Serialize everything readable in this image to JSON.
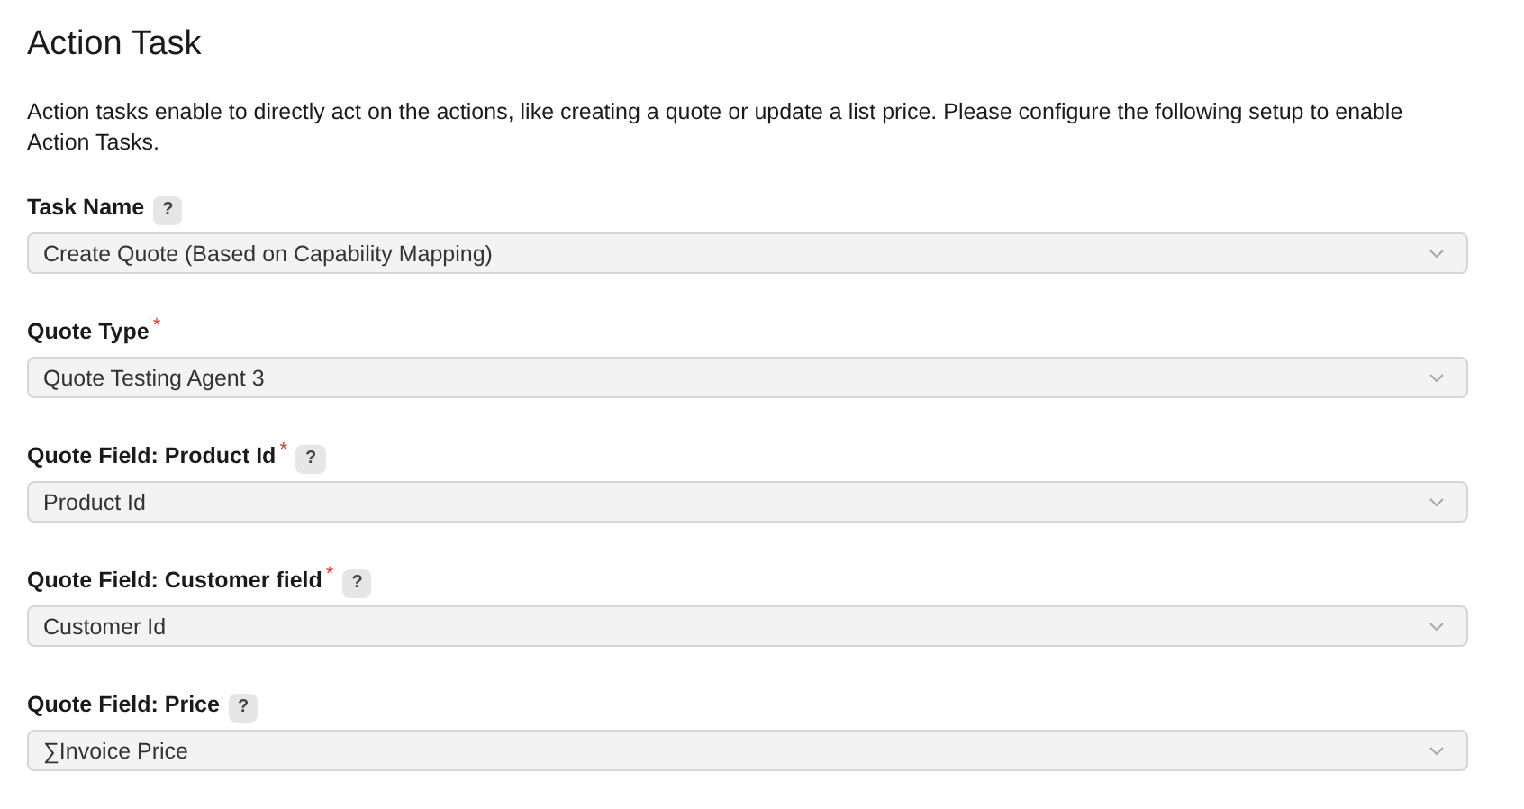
{
  "title": "Action Task",
  "description": "Action tasks enable to directly act on the actions, like creating a quote or update a list price. Please configure the following setup to enable Action Tasks.",
  "fields": [
    {
      "label": "Task Name",
      "help": "?",
      "value": "Create Quote (Based on Capability Mapping)"
    },
    {
      "label": "Quote Type",
      "required_mark": "*",
      "value": "Quote Testing Agent 3"
    },
    {
      "label": "Quote Field: Product Id",
      "required_mark": "*",
      "help": "?",
      "value": "Product Id"
    },
    {
      "label": "Quote Field: Customer field",
      "required_mark": "*",
      "help": "?",
      "value": "Customer Id"
    },
    {
      "label": "Quote Field: Price",
      "help": "?",
      "value": "∑Invoice Price"
    }
  ]
}
